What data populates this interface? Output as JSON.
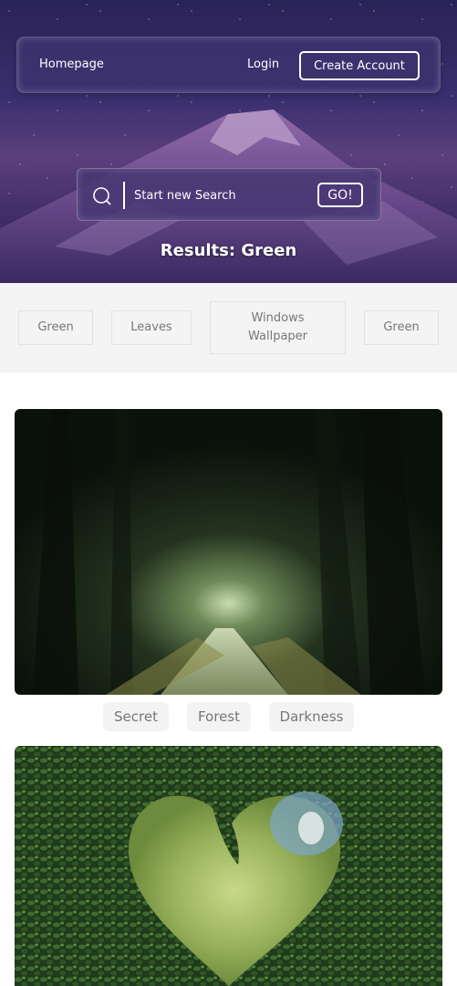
{
  "nav": {
    "home_label": "Homepage",
    "login_label": "Login",
    "create_account_label": "Create Account"
  },
  "search": {
    "placeholder": "Start new Search",
    "value": "",
    "go_label": "GO!",
    "icon": "search-icon"
  },
  "results": {
    "title": "Results: Green"
  },
  "tag_strip": {
    "tags": [
      "Green",
      "Leaves",
      "Windows Wallpaper",
      "Green"
    ]
  },
  "results_list": [
    {
      "image_description": "Dark forest path through tree tunnel",
      "tags": [
        "Secret",
        "Forest",
        "Darkness"
      ]
    },
    {
      "image_description": "Heart-shaped opening in green hedge"
    }
  ],
  "colors": {
    "hero_bg": "#3a2f6e",
    "nav_bg": "#3c326e",
    "tag_strip_bg": "#f4f4f4",
    "tag_text": "#777777"
  }
}
